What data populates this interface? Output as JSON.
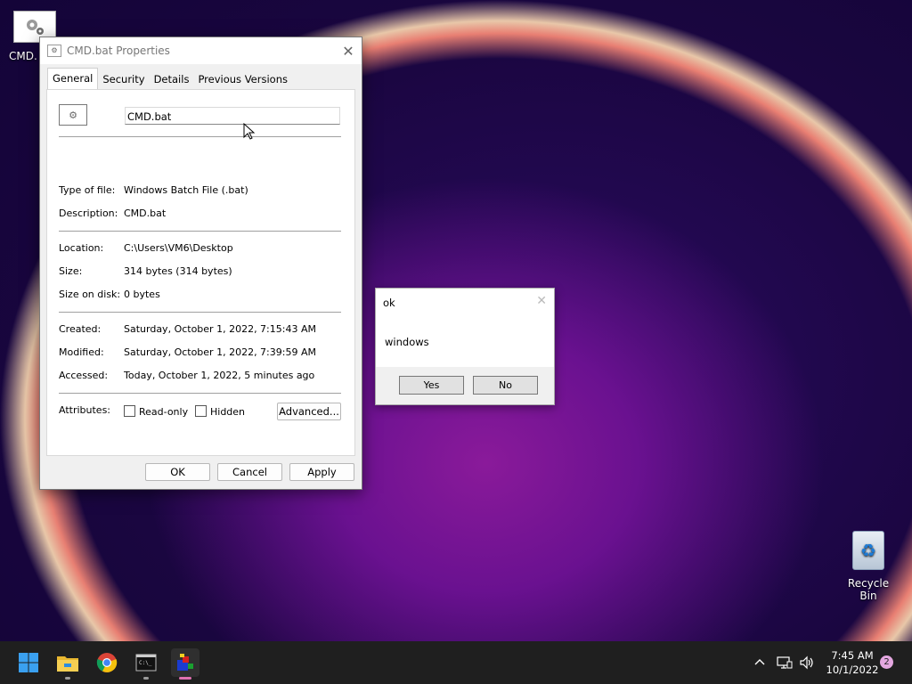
{
  "desktop": {
    "cmd_icon_label": "CMD.",
    "recycle_label": "Recycle Bin"
  },
  "properties": {
    "title": "CMD.bat Properties",
    "tabs": [
      "General",
      "Security",
      "Details",
      "Previous Versions"
    ],
    "filename": "CMD.bat",
    "type_label": "Type of file:",
    "type_value": "Windows Batch File (.bat)",
    "desc_label": "Description:",
    "desc_value": "CMD.bat",
    "location_label": "Location:",
    "location_value": "C:\\Users\\VM6\\Desktop",
    "size_label": "Size:",
    "size_value": "314 bytes (314 bytes)",
    "sizeondisk_label": "Size on disk:",
    "sizeondisk_value": "0 bytes",
    "created_label": "Created:",
    "created_value": "Saturday, October 1, 2022, 7:15:43 AM",
    "modified_label": "Modified:",
    "modified_value": "Saturday, October 1, 2022, 7:39:59 AM",
    "accessed_label": "Accessed:",
    "accessed_value": "Today, October 1, 2022, 5 minutes ago",
    "attributes_label": "Attributes:",
    "readonly_label": "Read-only",
    "hidden_label": "Hidden",
    "advanced_label": "Advanced...",
    "ok_label": "OK",
    "cancel_label": "Cancel",
    "apply_label": "Apply"
  },
  "message": {
    "title": "ok",
    "text": "windows",
    "yes_label": "Yes",
    "no_label": "No"
  },
  "taskbar": {
    "time": "7:45 AM",
    "date": "10/1/2022",
    "notification_count": "2"
  }
}
